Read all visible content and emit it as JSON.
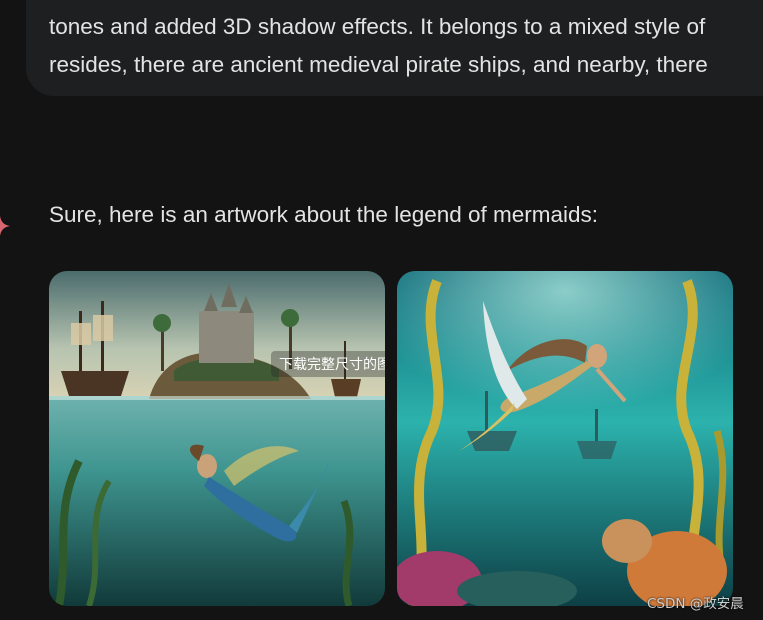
{
  "user_message": {
    "line1": "tones and added 3D shadow effects. It belongs to a mixed style of",
    "line2": "resides, there are ancient medieval pirate ships, and nearby, there"
  },
  "response": {
    "text": "Sure, here is an artwork about the legend of mermaids:",
    "icon": "sparkle-icon",
    "images": [
      {
        "name": "mermaid-image-1",
        "hover_label": "下载完整尺寸的图片"
      },
      {
        "name": "mermaid-image-2"
      }
    ]
  },
  "watermark": "CSDN @政安晨",
  "colors": {
    "background": "#131314",
    "bubble": "#1e1f20",
    "text": "#e3e3e3",
    "sparkle": "#d96570"
  }
}
